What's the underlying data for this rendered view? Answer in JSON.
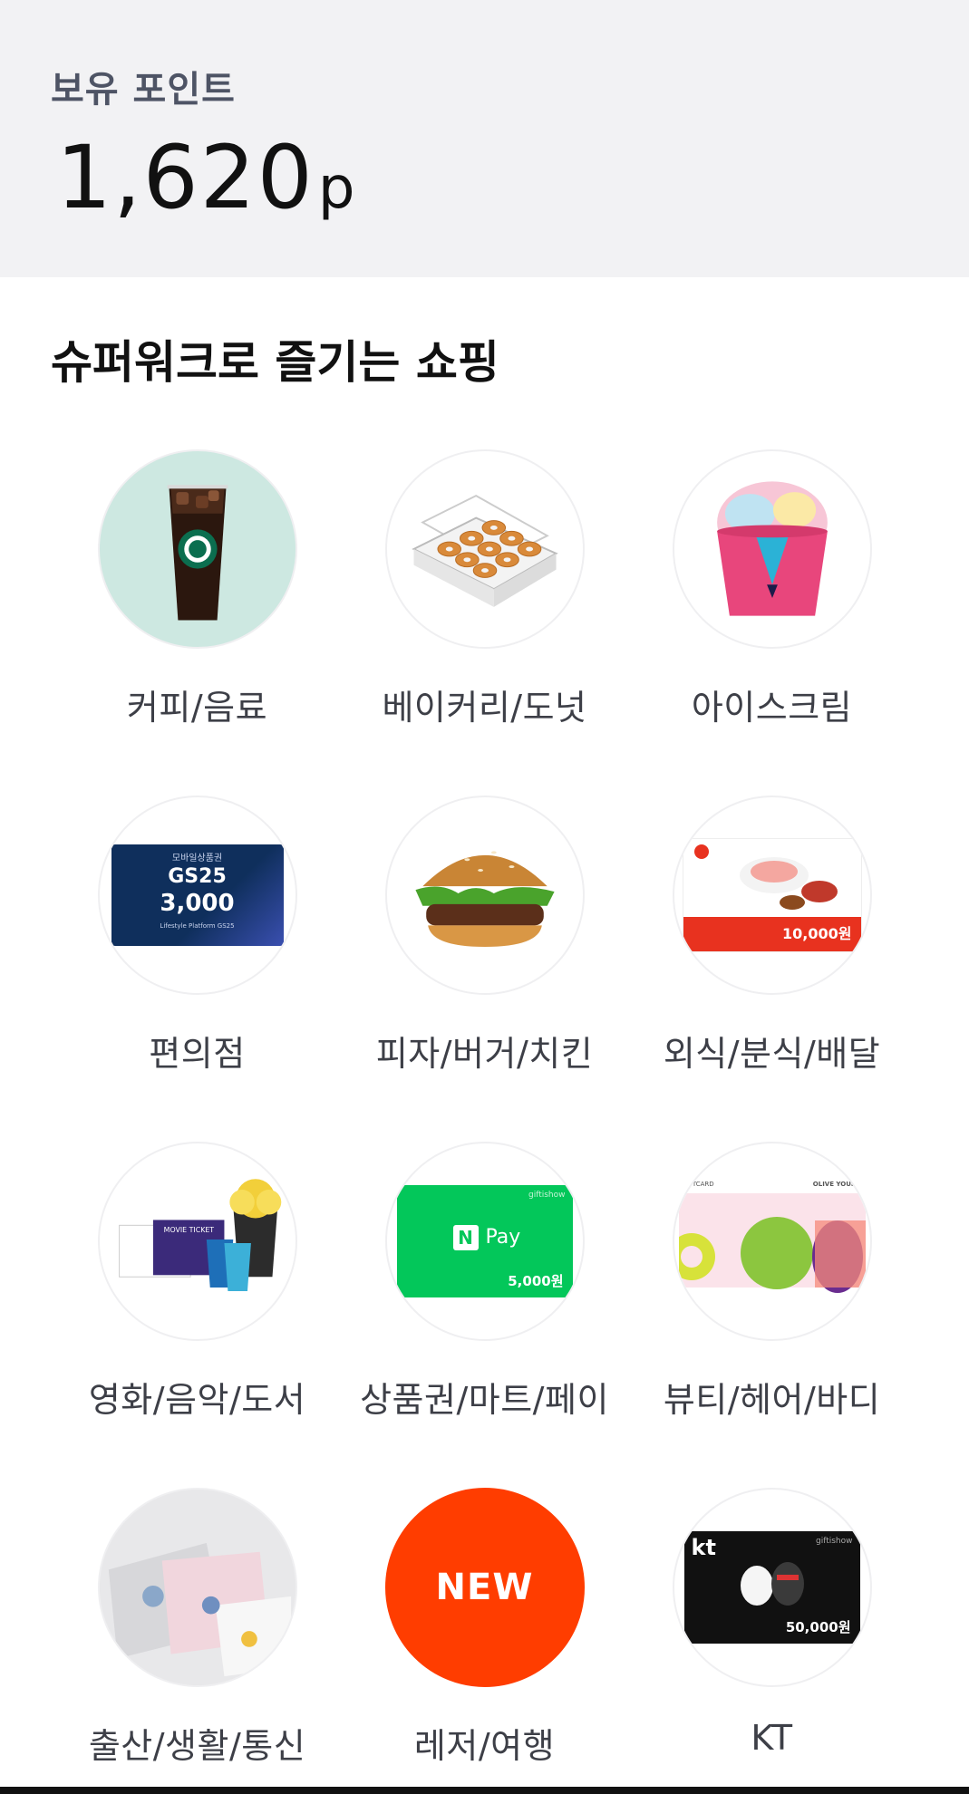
{
  "points": {
    "label": "보유 포인트",
    "value": "1,620",
    "unit": "p"
  },
  "section": {
    "title": "슈퍼워크로 즐기는 쇼핑"
  },
  "categories": [
    {
      "label": "커피/음료",
      "icon": "iced-coffee-icon"
    },
    {
      "label": "베이커리/도넛",
      "icon": "donut-box-icon"
    },
    {
      "label": "아이스크림",
      "icon": "ice-cream-cup-icon"
    },
    {
      "label": "편의점",
      "icon": "gs25-giftcard-icon",
      "card": {
        "top": "모바일상품권",
        "brand": "GS25",
        "amount": "3,000",
        "footer": "Lifestyle Platform  GS25"
      }
    },
    {
      "label": "피자/버거/치킨",
      "icon": "burger-icon"
    },
    {
      "label": "외식/분식/배달",
      "icon": "restaurant-voucher-icon",
      "card": {
        "amount": "10,000원"
      }
    },
    {
      "label": "영화/음악/도서",
      "icon": "movie-ticket-popcorn-icon",
      "card": {
        "ticket": "MOVIE TICKET"
      }
    },
    {
      "label": "상품권/마트/페이",
      "icon": "naver-pay-card-icon",
      "card": {
        "brand": "Pay",
        "badge": "N",
        "amount": "5,000원",
        "corner": "giftishow"
      }
    },
    {
      "label": "뷰티/헤어/바디",
      "icon": "olive-young-giftcard-icon",
      "card": {
        "left": "GIFTCARD",
        "brand": "OLIVE YOUNG"
      }
    },
    {
      "label": "출산/생활/통신",
      "icon": "towels-icon"
    },
    {
      "label": "레저/여행",
      "icon": "new-badge-icon",
      "badge_text": "NEW"
    },
    {
      "label": "KT",
      "icon": "kt-giftcard-icon",
      "card": {
        "brand": "kt",
        "corner": "giftishow",
        "amount": "50,000원"
      }
    }
  ],
  "colors": {
    "header_bg": "#f2f2f4",
    "new_badge": "#ff3d00",
    "naver_green": "#03c75a",
    "gs25_navy": "#123a6b",
    "restaurant_red": "#e8321f"
  }
}
